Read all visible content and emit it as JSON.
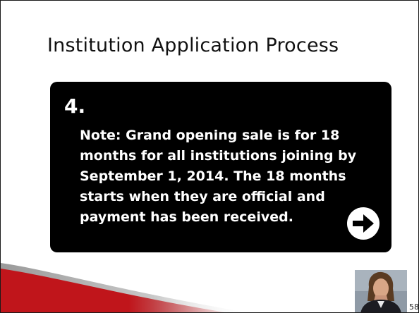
{
  "slide": {
    "title": "Institution Application Process",
    "step_number": "4.",
    "note_text": "Note: Grand opening sale is for 18 months for all institutions joining by September 1, 2014. The 18 months starts when they are official and payment has been received.",
    "page_number": "58"
  },
  "icons": {
    "next": "arrow-right-circle-icon",
    "presenter": "presenter-photo"
  },
  "colors": {
    "card_background": "#000000",
    "card_text": "#ffffff",
    "accent_red": "#c0151b",
    "title_text": "#111111"
  }
}
